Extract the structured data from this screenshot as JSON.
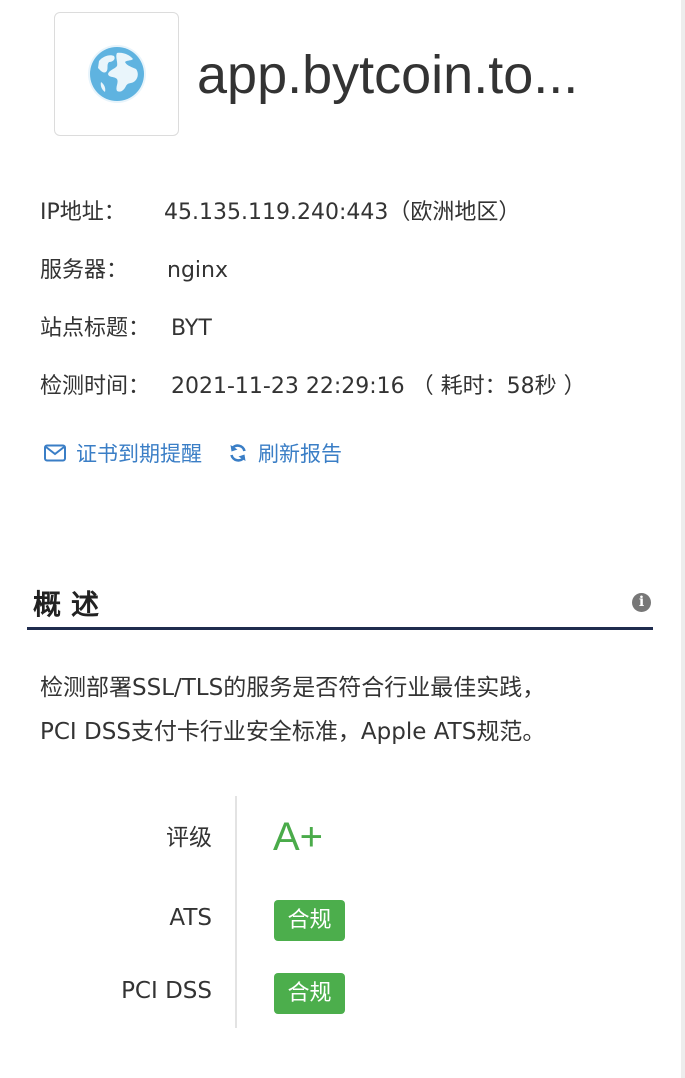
{
  "site": {
    "host": "app.bytcoin.to...",
    "icon": "globe-icon"
  },
  "info": {
    "ip_label": "IP地址：",
    "ip_value": "45.135.119.240:443（欧洲地区）",
    "server_label": "服务器：",
    "server_value": "nginx",
    "title_label": "站点标题：",
    "title_value": "BYT",
    "time_label": "检测时间：",
    "time_value": "2021-11-23 22:29:16 （ 耗时：58秒 ）"
  },
  "actions": {
    "cert_reminder": "证书到期提醒",
    "refresh_report": "刷新报告"
  },
  "overview": {
    "title": "概述",
    "line1": "检测部署SSL/TLS的服务是否符合行业最佳实践，",
    "line2": "PCI DSS支付卡行业安全标准，Apple ATS规范。"
  },
  "results": {
    "grade_label": "评级",
    "grade_value": "A+",
    "ats_label": "ATS",
    "ats_value": "合规",
    "pci_label": "PCI DSS",
    "pci_value": "合规"
  },
  "colors": {
    "accent": "#3a7ec6",
    "success": "#4cae4c",
    "rule": "#1f2c4e"
  }
}
